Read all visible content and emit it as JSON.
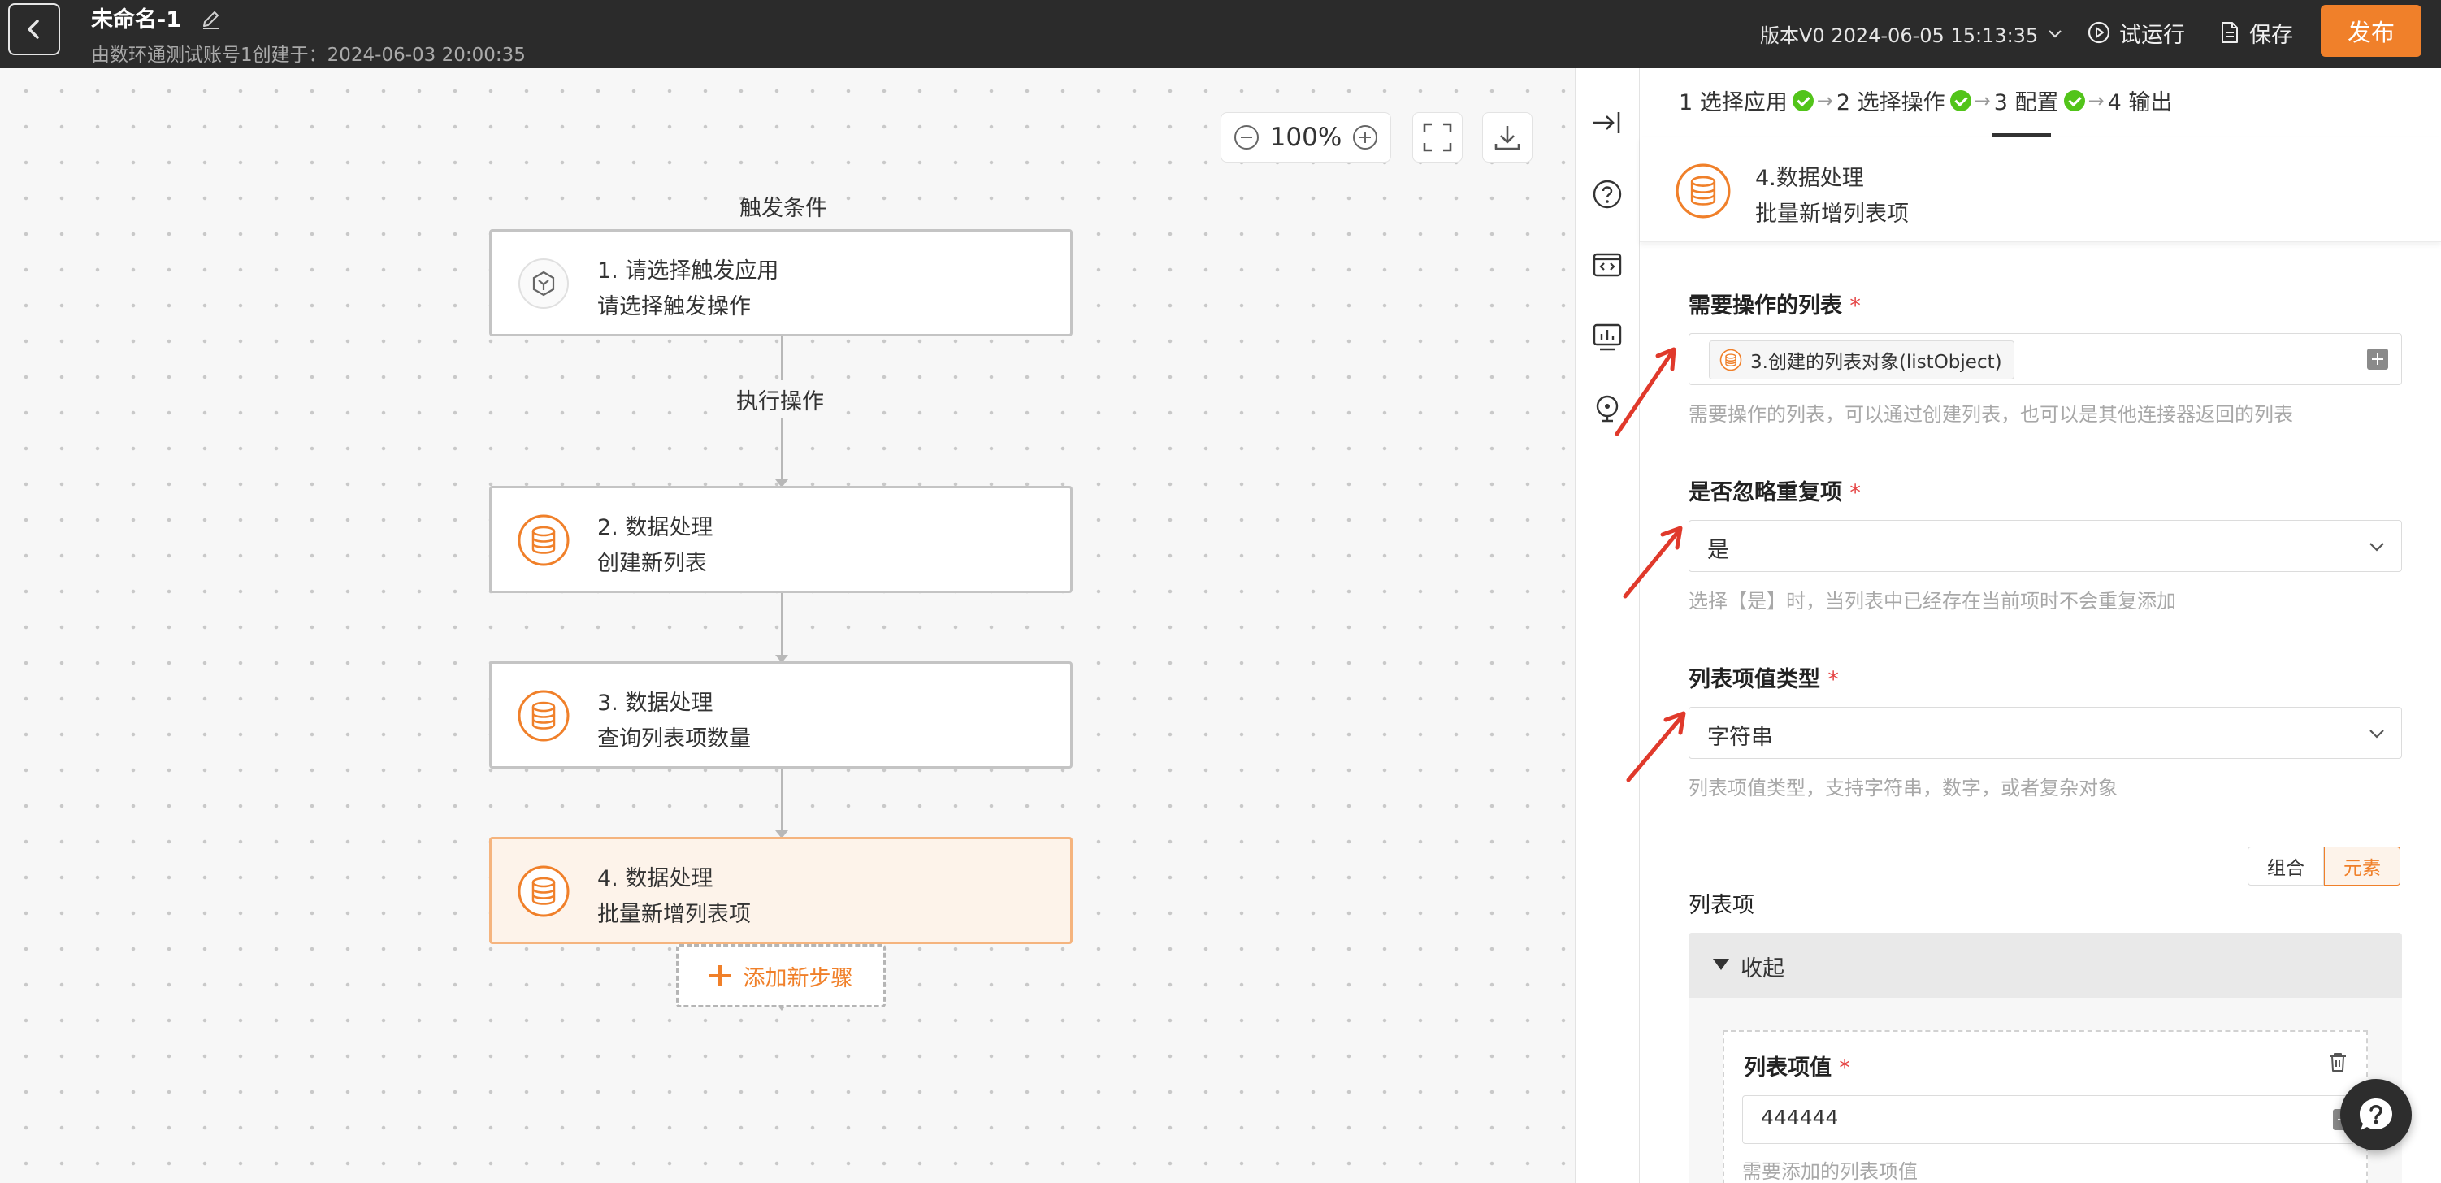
{
  "header": {
    "title": "未命名-1",
    "subtitle": "由数环通测试账号1创建于：2024-06-03 20:00:35",
    "version": "版本V0 2024-06-05 15:13:35",
    "run_label": "试运行",
    "save_label": "保存",
    "publish_label": "发布"
  },
  "canvas": {
    "zoom": "100%",
    "trigger_label": "触发条件",
    "action_label": "执行操作",
    "add_step_label": "添加新步骤",
    "nodes": [
      {
        "line1": "1. 请选择触发应用",
        "line2": "请选择触发操作",
        "icon": "hexagon-app-icon"
      },
      {
        "line1": "2. 数据处理",
        "line2": "创建新列表",
        "icon": "database-icon"
      },
      {
        "line1": "3. 数据处理",
        "line2": "查询列表项数量",
        "icon": "database-icon"
      },
      {
        "line1": "4. 数据处理",
        "line2": "批量新增列表项",
        "icon": "database-icon",
        "active": true
      }
    ]
  },
  "panel": {
    "steps": [
      {
        "label": "1 选择应用",
        "done": true
      },
      {
        "label": "2 选择操作",
        "done": true
      },
      {
        "label": "3 配置",
        "done": true
      },
      {
        "label": "4 输出",
        "done": false
      }
    ],
    "step_arrow": "→",
    "head_line1": "4.数据处理",
    "head_line2": "批量新增列表项",
    "required_mark": "*",
    "list_field": {
      "label": "需要操作的列表",
      "tag": "3.创建的列表对象(listObject)",
      "hint": "需要操作的列表，可以通过创建列表，也可以是其他连接器返回的列表"
    },
    "ignore_field": {
      "label": "是否忽略重复项",
      "value": "是",
      "hint": "选择【是】时，当列表中已经存在当前项时不会重复添加"
    },
    "type_field": {
      "label": "列表项值类型",
      "value": "字符串",
      "hint": "列表项值类型，支持字符串，数字，或者复杂对象"
    },
    "mode_toggle": {
      "combo": "组合",
      "element": "元素",
      "selected": "元素"
    },
    "items_label": "列表项",
    "collapse_label": "收起",
    "item": {
      "label": "列表项值",
      "value": "444444",
      "hint": "需要添加的列表项值"
    }
  },
  "colors": {
    "accent": "#f0802a",
    "success": "#52c41a",
    "topbar": "#2b2b2b",
    "arrow": "#e0392b"
  }
}
